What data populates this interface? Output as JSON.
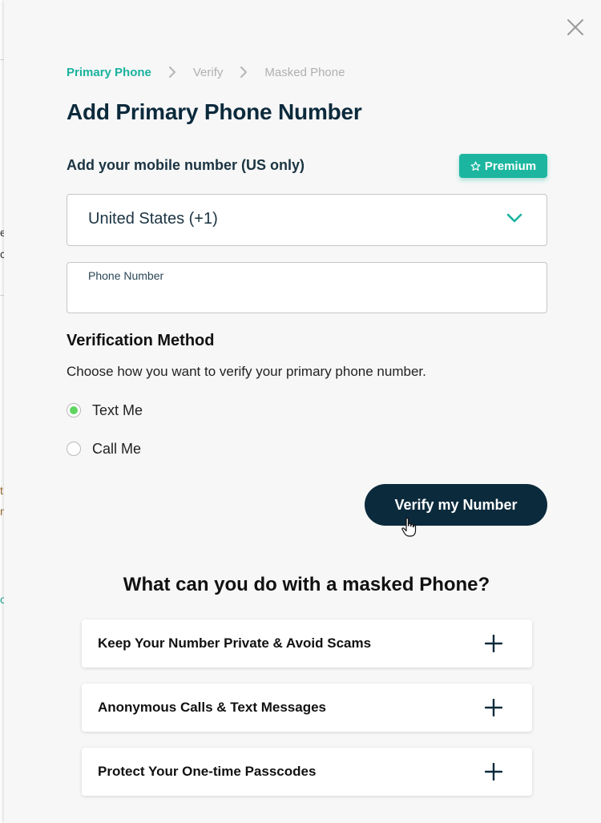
{
  "modal": {
    "breadcrumb": [
      "Primary Phone",
      "Verify",
      "Masked Phone"
    ],
    "title": "Add Primary Phone Number",
    "mobile_label": "Add your mobile number (US only)",
    "premium_badge": "Premium",
    "country_select": {
      "value": "United States (+1)"
    },
    "phone_field": {
      "label": "Phone Number",
      "value": ""
    },
    "verification": {
      "heading": "Verification Method",
      "description": "Choose how you want to verify your primary phone number.",
      "options": [
        {
          "label": "Text Me",
          "selected": true
        },
        {
          "label": "Call Me",
          "selected": false
        }
      ]
    },
    "verify_button": "Verify my Number",
    "faq": {
      "heading": "What can you do with a masked Phone?",
      "items": [
        "Keep Your Number Private & Avoid Scams",
        "Anonymous Calls & Text Messages",
        "Protect Your One-time Passcodes"
      ]
    }
  },
  "colors": {
    "accent": "#1ab29f",
    "premium": "#1cb6a0",
    "primary_dark": "#0b2a3c",
    "radio_selected": "#5fd65f"
  },
  "icons": [
    "close-icon",
    "chevron-right-icon",
    "chevron-down-icon",
    "star-icon",
    "plus-icon",
    "hand-pointer-cursor"
  ]
}
